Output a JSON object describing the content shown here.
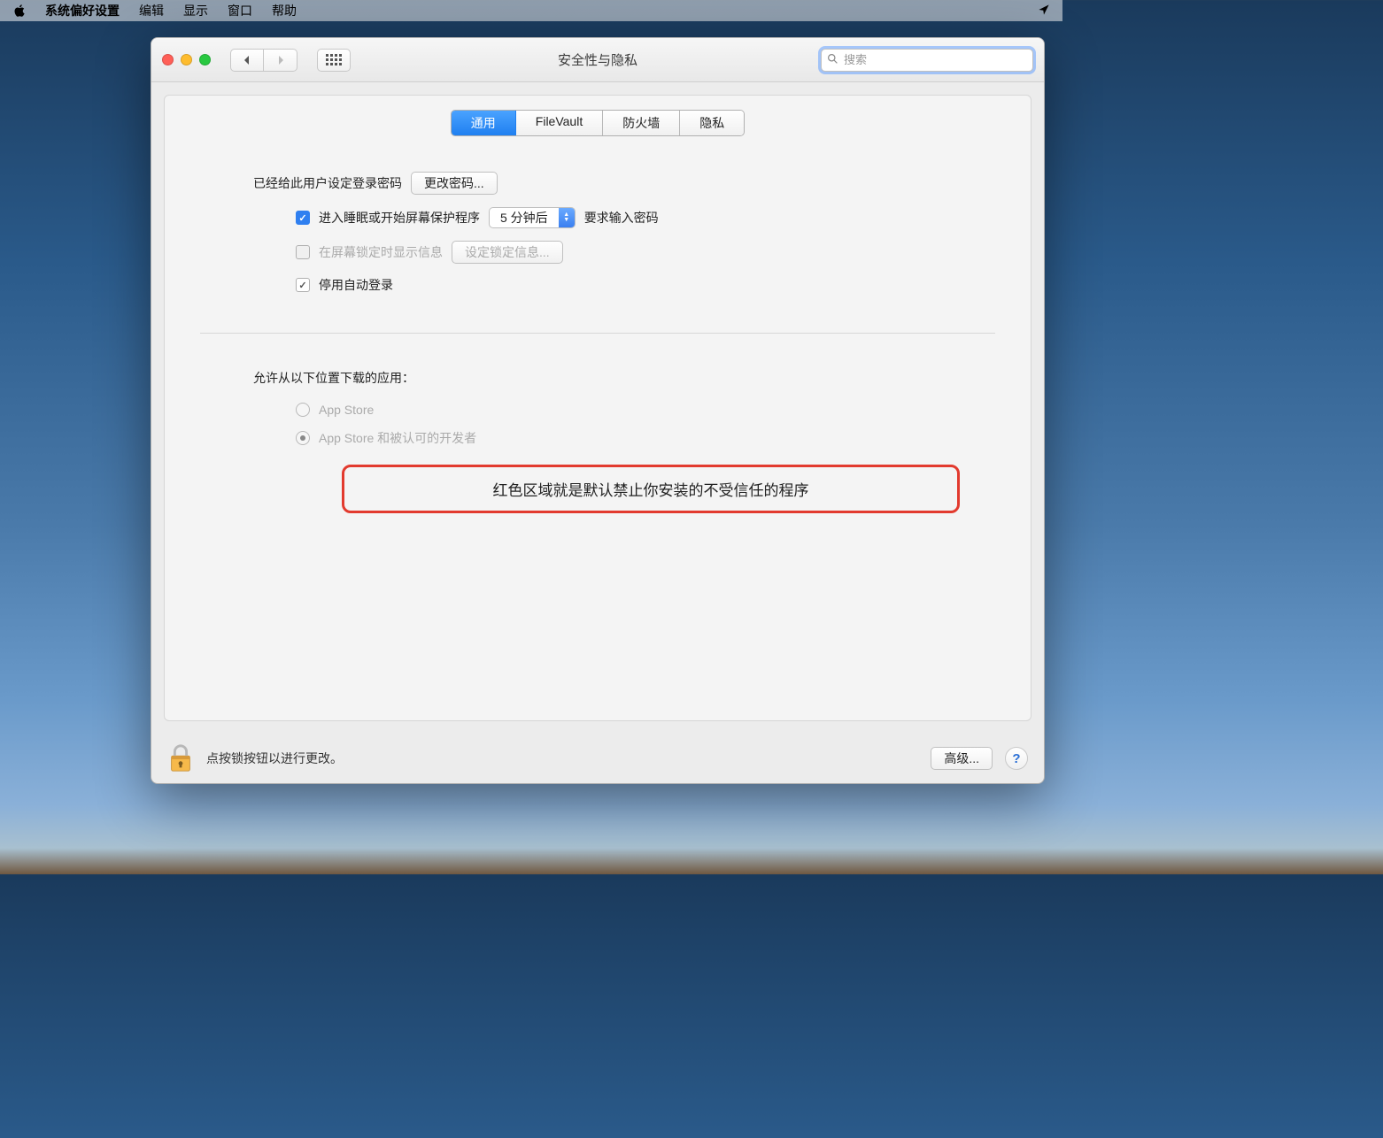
{
  "menubar": {
    "app_name": "系统偏好设置",
    "items": [
      "编辑",
      "显示",
      "窗口",
      "帮助"
    ]
  },
  "window": {
    "title": "安全性与隐私",
    "search_placeholder": "搜索"
  },
  "tabs": {
    "general": "通用",
    "filevault": "FileVault",
    "firewall": "防火墙",
    "privacy": "隐私"
  },
  "general": {
    "password_set_label": "已经给此用户设定登录密码",
    "change_password_btn": "更改密码...",
    "require_password_prefix": "进入睡眠或开始屏幕保护程序",
    "require_password_delay": "5 分钟后",
    "require_password_suffix": "要求输入密码",
    "show_message_label": "在屏幕锁定时显示信息",
    "set_lock_message_btn": "设定锁定信息...",
    "disable_autologin_label": "停用自动登录",
    "allow_downloads_heading": "允许从以下位置下载的应用：",
    "radio_appstore": "App Store",
    "radio_identified": "App Store 和被认可的开发者",
    "annotation": "红色区域就是默认禁止你安装的不受信任的程序"
  },
  "footer": {
    "lock_hint": "点按锁按钮以进行更改。",
    "advanced_btn": "高级...",
    "help": "?"
  }
}
